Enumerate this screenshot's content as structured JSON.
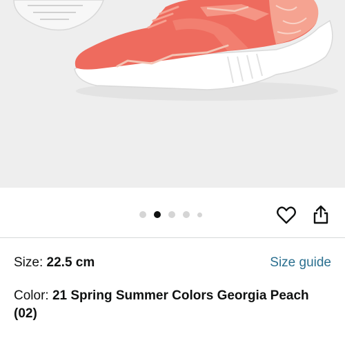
{
  "gallery": {
    "image_description_icon": "sneaker-product-image",
    "dots_total": 5,
    "active_dot_index": 1
  },
  "actions": {
    "wishlist_icon": "heart-outline-icon",
    "share_icon": "share-icon"
  },
  "variations": {
    "size_label": "Size: ",
    "size_value": "22.5 cm",
    "size_guide_label": "Size guide",
    "color_label": "Color: ",
    "color_value": "21 Spring Summer Colors Georgia Peach (02)"
  },
  "colors": {
    "link": "#2a6f8f",
    "shoe_upper": "#ee6b5e",
    "shoe_accent": "#f3b6a6",
    "sole": "#ffffff",
    "background": "#eeeeee"
  }
}
